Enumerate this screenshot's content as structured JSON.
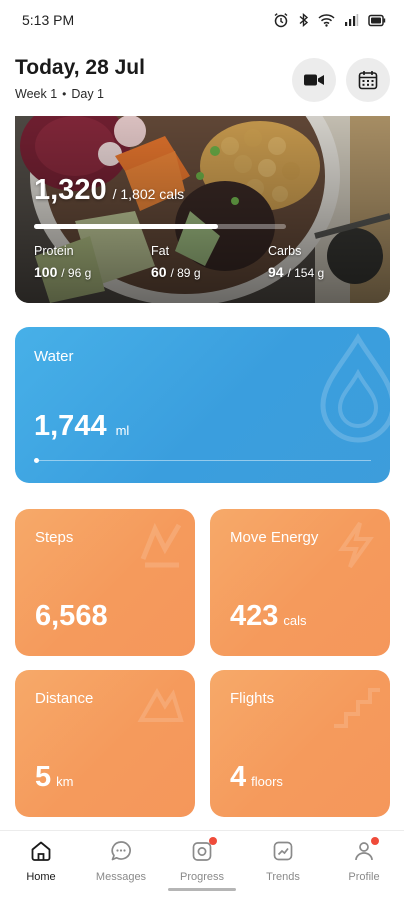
{
  "status_bar": {
    "time": "5:13 PM"
  },
  "header": {
    "title": "Today, 28 Jul",
    "week": "Week 1",
    "separator": "•",
    "day": "Day 1"
  },
  "calories": {
    "consumed": "1,320",
    "target": "/ 1,802 cals",
    "progress": 0.73
  },
  "macros": [
    {
      "label": "Protein",
      "value": "100",
      "target": "/ 96 g"
    },
    {
      "label": "Fat",
      "value": "60",
      "target": "/ 89 g"
    },
    {
      "label": "Carbs",
      "value": "94",
      "target": "/ 154 g"
    }
  ],
  "water": {
    "title": "Water",
    "value": "1,744",
    "unit": "ml",
    "progress": 0.0
  },
  "stats": [
    {
      "title": "Steps",
      "value": "6,568",
      "unit": ""
    },
    {
      "title": "Move Energy",
      "value": "423",
      "unit": "cals"
    },
    {
      "title": "Distance",
      "value": "5",
      "unit": "km"
    },
    {
      "title": "Flights",
      "value": "4",
      "unit": "floors"
    }
  ],
  "tabs": [
    {
      "label": "Home",
      "icon": "home-icon",
      "active": true
    },
    {
      "label": "Messages",
      "icon": "chat-icon",
      "active": false
    },
    {
      "label": "Progress",
      "icon": "camera-icon",
      "active": false
    },
    {
      "label": "Trends",
      "icon": "trend-icon",
      "active": false
    },
    {
      "label": "Profile",
      "icon": "profile-icon",
      "active": false
    }
  ],
  "colors": {
    "water_card": "#3d9ddb",
    "stat_card": "#f59a5c",
    "badge": "#ef4b3a"
  }
}
